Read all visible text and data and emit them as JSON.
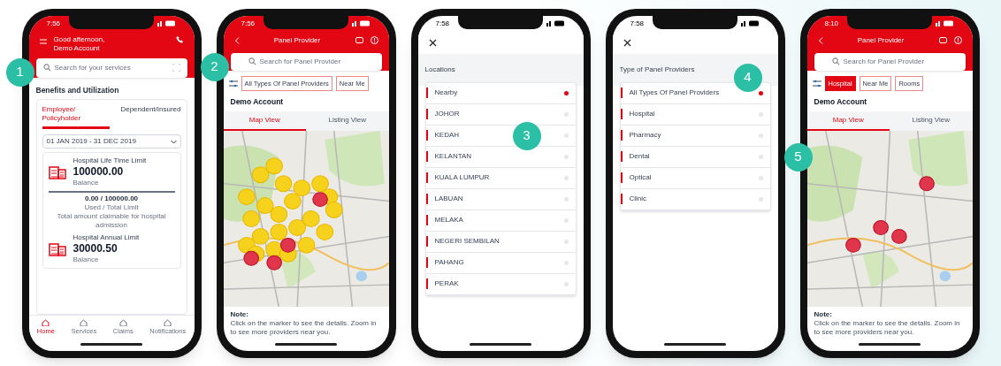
{
  "phones": [
    {
      "kind": "benefits",
      "badge": "1",
      "time": "7:56",
      "greeting": "Good afternoon,",
      "account": "Demo Account",
      "search": {
        "placeholder": "Search for your services"
      },
      "section": "Benefits and Utilization",
      "tabs": [
        {
          "label": "Employee/ Policyholder",
          "selected": true
        },
        {
          "label": "Dependent/Insured",
          "selected": false
        }
      ],
      "period": "01 JAN 2019 - 31 DEC 2019",
      "cards": [
        {
          "title": "Hospital Life Time Limit",
          "amount": "100000.00",
          "caption": "Balance",
          "used": "0.00 / 100000.00",
          "used_caption": "Used / Total Limit",
          "note": "Total amount claimable for hospital admission"
        },
        {
          "title": "Hospital Annual Limit",
          "amount": "30000.50",
          "caption": "Balance"
        }
      ],
      "nav": [
        {
          "label": "Home",
          "selected": true
        },
        {
          "label": "Services",
          "selected": false
        },
        {
          "label": "Claims",
          "selected": false
        },
        {
          "label": "Notifications",
          "selected": false
        }
      ]
    },
    {
      "kind": "map",
      "badge": "2",
      "time": "7:56",
      "title": "Panel Provider",
      "search": {
        "placeholder": "Search for Panel Provider"
      },
      "filters": [
        {
          "label": "All Types Of Panel Providers",
          "selected": false
        },
        {
          "label": "Near Me",
          "selected": false
        }
      ],
      "account": "Demo Account",
      "tabs": [
        {
          "label": "Map View",
          "selected": true
        },
        {
          "label": "Listing View",
          "selected": false
        }
      ],
      "note_title": "Note:",
      "note": "Click on the marker to see the details. Zoom in to see more providers near you."
    },
    {
      "kind": "picker",
      "badge": "3",
      "time": "7:58",
      "heading": "Locations",
      "options": [
        {
          "label": "Nearby",
          "selected": true
        },
        {
          "label": "JOHOR",
          "selected": false
        },
        {
          "label": "KEDAH",
          "selected": false
        },
        {
          "label": "KELANTAN",
          "selected": false
        },
        {
          "label": "KUALA LUMPUR",
          "selected": false
        },
        {
          "label": "LABUAN",
          "selected": false
        },
        {
          "label": "MELAKA",
          "selected": false
        },
        {
          "label": "NEGERI SEMBILAN",
          "selected": false
        },
        {
          "label": "PAHANG",
          "selected": false
        },
        {
          "label": "PERAK",
          "selected": false
        }
      ]
    },
    {
      "kind": "picker",
      "badge": "4",
      "time": "7:58",
      "heading": "Type of Panel Providers",
      "options": [
        {
          "label": "All Types Of Panel Providers",
          "selected": true
        },
        {
          "label": "Hospital",
          "selected": false
        },
        {
          "label": "Pharmacy",
          "selected": false
        },
        {
          "label": "Dental",
          "selected": false
        },
        {
          "label": "Optical",
          "selected": false
        },
        {
          "label": "Clinic",
          "selected": false
        }
      ]
    },
    {
      "kind": "map",
      "badge": "5",
      "time": "8:10",
      "title": "Panel Provider",
      "search": {
        "placeholder": "Search for Panel Provider"
      },
      "filters": [
        {
          "label": "Hospital",
          "selected": true
        },
        {
          "label": "Near Me",
          "selected": false
        },
        {
          "label": "Rooms",
          "selected": false
        }
      ],
      "account": "Demo Account",
      "tabs": [
        {
          "label": "Map View",
          "selected": true
        },
        {
          "label": "Listing View",
          "selected": false
        }
      ],
      "note_title": "Note:",
      "note": "Click on the marker to see the details. Zoom in to see more providers near you."
    }
  ]
}
